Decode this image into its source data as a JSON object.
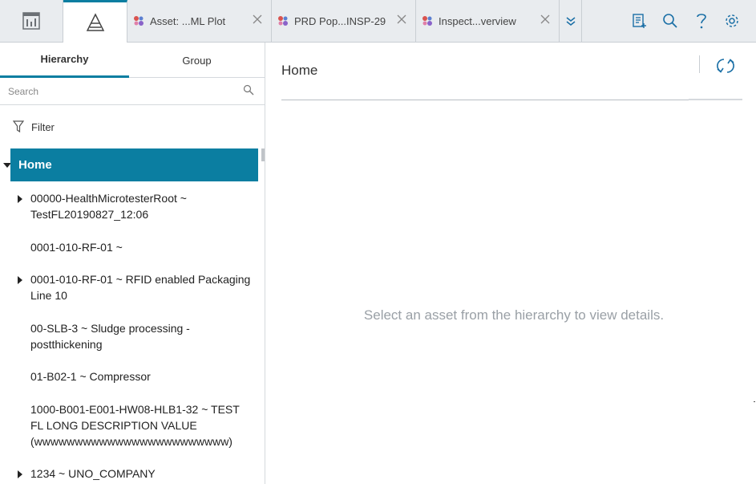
{
  "topbar": {
    "tabs": [
      {
        "label": "Asset: ...ML Plot"
      },
      {
        "label": "PRD Pop...INSP-29"
      },
      {
        "label": "Inspect...verview"
      }
    ]
  },
  "left_panel": {
    "tabs": {
      "hierarchy": "Hierarchy",
      "group": "Group"
    },
    "search": {
      "placeholder": "Search"
    },
    "filter_label": "Filter",
    "tree": {
      "root": "Home",
      "items": [
        {
          "label": "00000-HealthMicrotesterRoot ~ TestFL20190827_12:06",
          "expandable": true
        },
        {
          "label": "0001-010-RF-01 ~",
          "expandable": false
        },
        {
          "label": "0001-010-RF-01 ~ RFID enabled Packaging Line 10",
          "expandable": true
        },
        {
          "label": "00-SLB-3 ~ Sludge processing - postthickening",
          "expandable": false
        },
        {
          "label": "01-B02-1 ~ Compressor",
          "expandable": false
        },
        {
          "label": "1000-B001-E001-HW08-HLB1-32 ~ TEST FL LONG DESCRIPTION VALUE (wwwwwwwwwwwwwwwwwwwwwwww)",
          "expandable": false
        },
        {
          "label": "1234 ~ UNO_COMPANY",
          "expandable": true
        }
      ]
    }
  },
  "right_panel": {
    "title": "Home",
    "empty_message": "Select an asset from the hierarchy to view details."
  },
  "colors": {
    "accent": "#0b7ea1",
    "toolbar_icon": "#1a6fa6",
    "topbar_bg": "#e9ecef"
  }
}
